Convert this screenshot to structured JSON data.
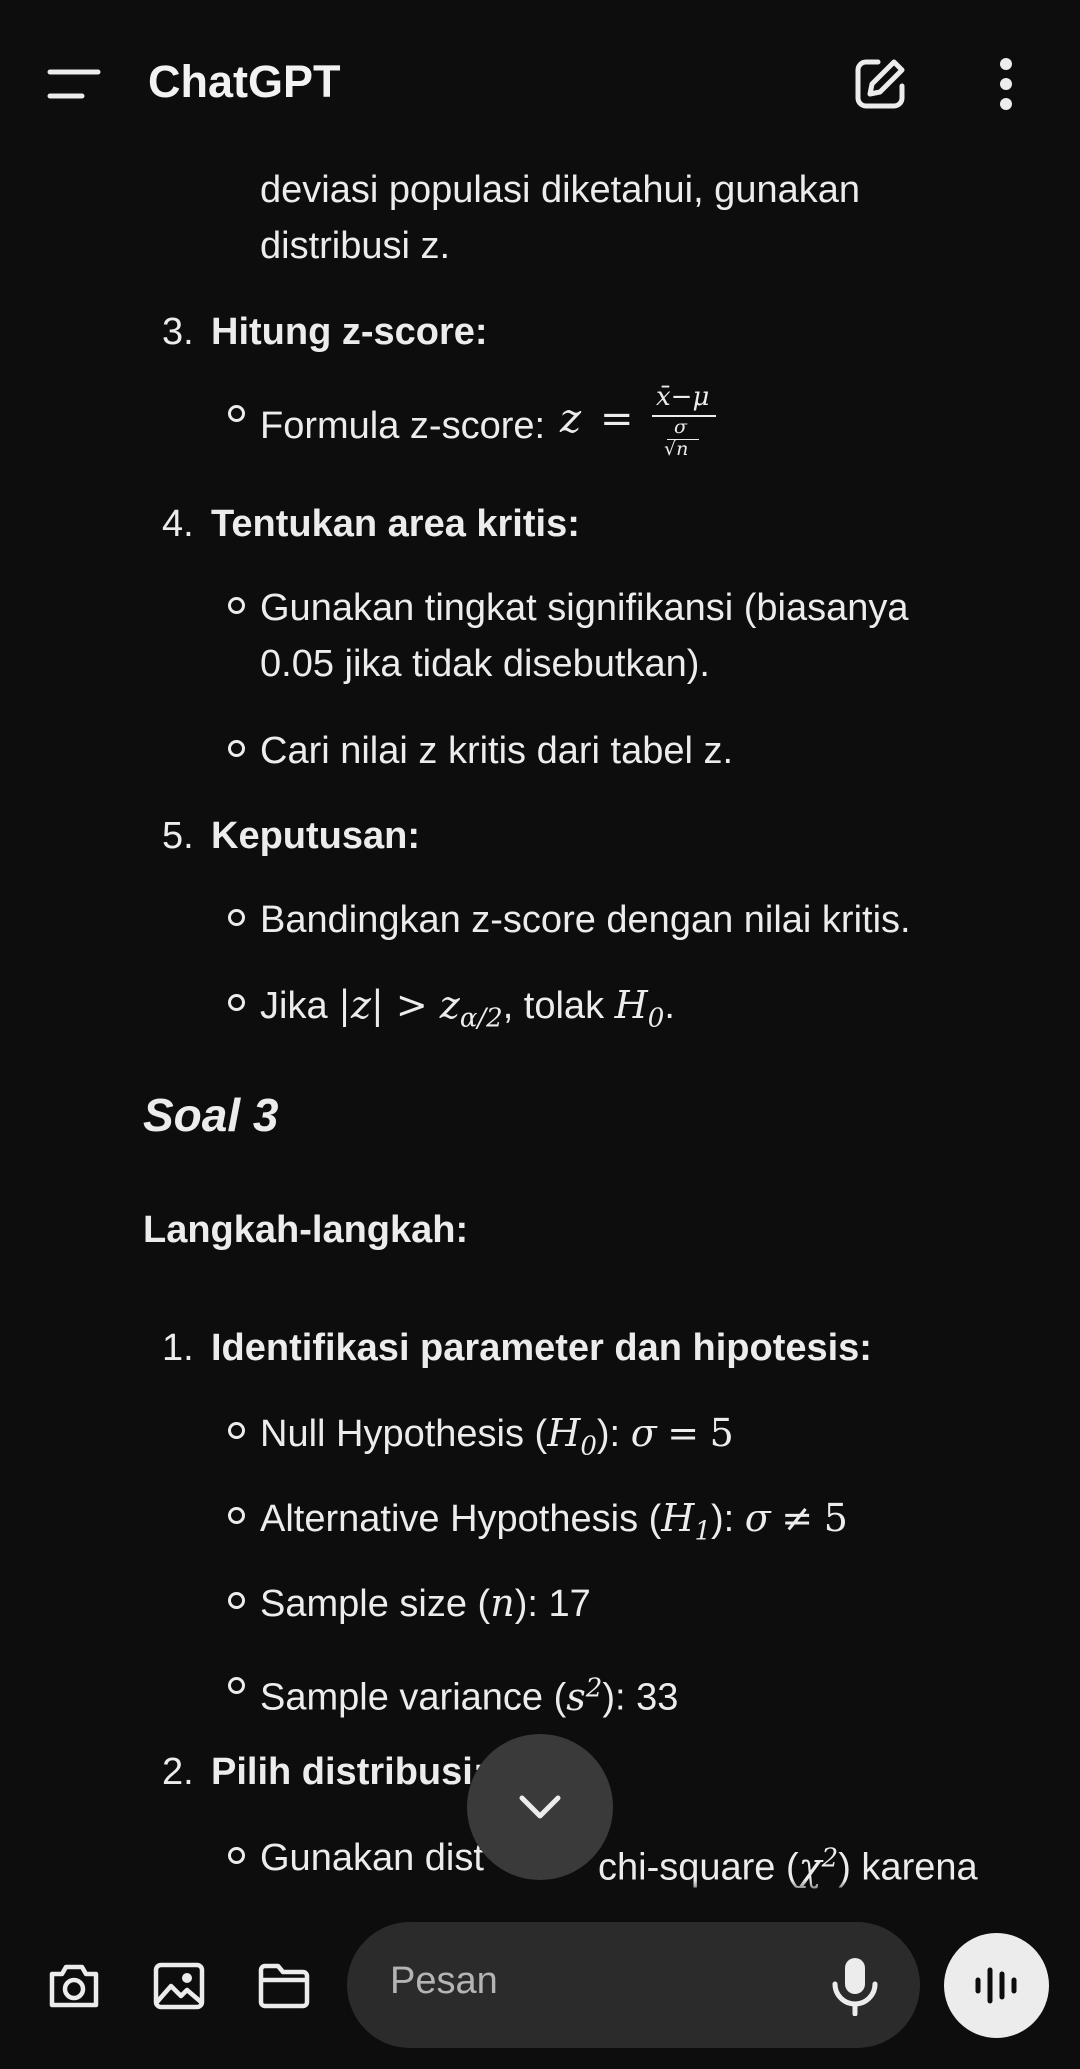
{
  "header": {
    "title": "ChatGPT"
  },
  "content": {
    "continuation_line1": "deviasi populasi diketahui, gunakan",
    "continuation_line2": "distribusi z.",
    "steps_a": [
      {
        "num": "3.",
        "title": "Hitung z-score:"
      },
      {
        "num": "4.",
        "title": "Tentukan area kritis:"
      },
      {
        "num": "5.",
        "title": "Keputusan:"
      }
    ],
    "formula_label": "Formula z-score:",
    "critical_line1": "Gunakan tingkat signifikansi (biasanya",
    "critical_line2": "0.05 jika tidak disebutkan).",
    "critical_table": "Cari nilai z kritis dari tabel z.",
    "compare": "Bandingkan z-score dengan nilai kritis.",
    "reject_prefix": "Jika",
    "reject_mid": ", tolak",
    "soal_heading": "Soal 3",
    "langkah_heading": "Langkah-langkah:",
    "steps_b": [
      {
        "num": "1.",
        "title": "Identifikasi parameter dan hipotesis:"
      },
      {
        "num": "2.",
        "title": "Pilih distribusi:"
      }
    ],
    "null_label": "Null Hypothesis (",
    "null_value": "5",
    "alt_label": "Alternative Hypothesis (",
    "alt_value": "5",
    "sample_size_label": "Sample size (",
    "sample_size_value": "17",
    "sample_var_label": "Sample variance (",
    "sample_var_value": "33",
    "dist_prefix": "Gunakan dist",
    "dist_suffix": "chi-square (",
    "dist_end": ") karena"
  },
  "composer": {
    "placeholder": "Pesan",
    "icons": [
      "camera-icon",
      "image-icon",
      "folder-icon",
      "microphone-icon",
      "voice-mode-icon"
    ]
  },
  "scroll_button": {
    "icon": "chevron-down-icon"
  }
}
